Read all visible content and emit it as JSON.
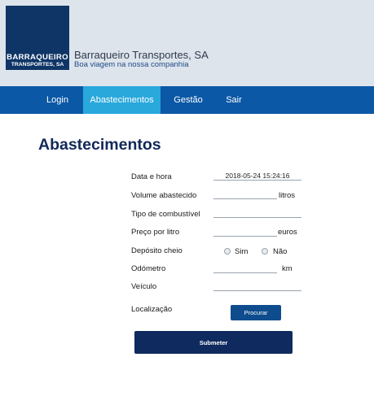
{
  "header": {
    "logo_line1": "BARRAQUEIRO",
    "logo_line2": "TRANSPORTES, SA",
    "company_name": "Barraqueiro Transportes, SA",
    "slogan": "Boa viagem na nossa companhia"
  },
  "nav": {
    "items": [
      {
        "label": "Login"
      },
      {
        "label": "Abastecimentos",
        "active": true
      },
      {
        "label": "Gestão"
      },
      {
        "label": "Sair"
      }
    ]
  },
  "page": {
    "title": "Abastecimentos"
  },
  "form": {
    "datetime": {
      "label": "Data e hora",
      "value": "2018-05-24 15:24:16"
    },
    "volume": {
      "label": "Volume abastecido",
      "value": "",
      "unit": "litros"
    },
    "fuel_type": {
      "label": "Tipo de combustível",
      "value": ""
    },
    "price": {
      "label": "Preço por litro",
      "value": "",
      "unit": "euros"
    },
    "full_tank": {
      "label": "Depósito cheio",
      "yes_label": "Sim",
      "no_label": "Não"
    },
    "odometer": {
      "label": "Odómetro",
      "value": "",
      "unit": "km"
    },
    "vehicle": {
      "label": "Veículo",
      "value": ""
    },
    "location": {
      "label": "Localização",
      "button_label": "Procurar"
    },
    "submit_label": "Submeter"
  },
  "colors": {
    "header_bg": "#dde4ec",
    "logo_bg": "#0f3566",
    "nav_bg": "#0b58a6",
    "nav_active": "#29a8dc",
    "title": "#12285a",
    "submit_bg": "#0f2a5e"
  }
}
